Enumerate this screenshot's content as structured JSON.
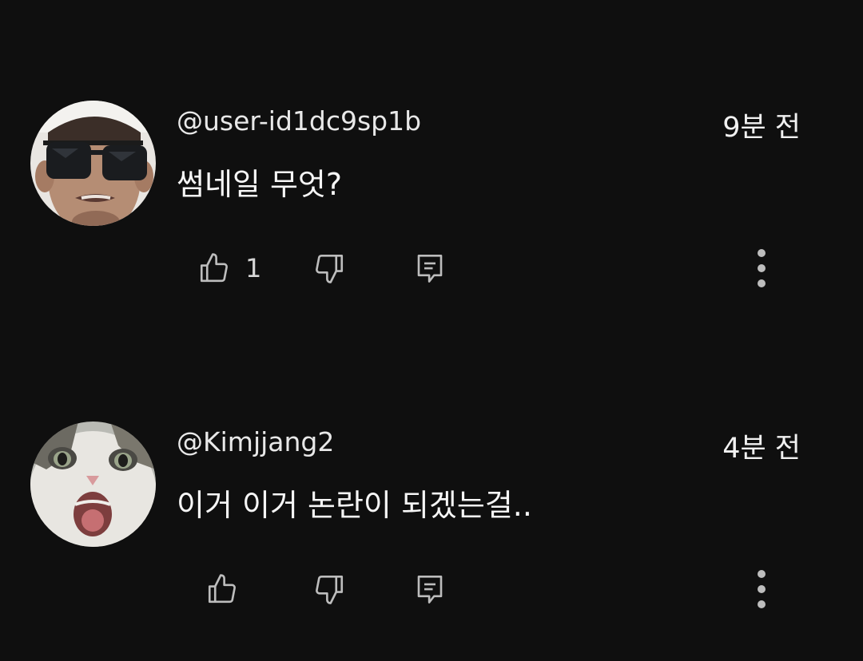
{
  "comments": [
    {
      "author": "@user-id1dc9sp1b",
      "time": "9분 전",
      "text": "썸네일 무엇?",
      "likes": "1",
      "avatar": "man-sunglasses-avatar"
    },
    {
      "author": "@Kimjjang2",
      "time": "4분 전",
      "text": "이거 이거 논란이 되겠는걸..",
      "likes": "",
      "avatar": "cat-avatar"
    }
  ],
  "icons": {
    "like": "thumbs-up-icon",
    "dislike": "thumbs-down-icon",
    "reply": "reply-icon",
    "more": "more-vertical-icon"
  },
  "colors": {
    "background": "#0f0f0f",
    "text": "#f1f1f1",
    "icon": "#bdbdbd"
  }
}
